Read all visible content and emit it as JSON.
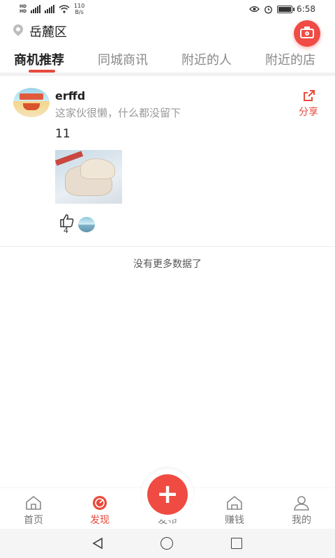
{
  "status_bar": {
    "net_speed_value": "110",
    "net_speed_unit": "B/s",
    "time": "6:58",
    "battery_level": 0.9
  },
  "header": {
    "location": "岳麓区"
  },
  "tabs": [
    {
      "label": "商机推荐",
      "active": true
    },
    {
      "label": "同城商讯",
      "active": false
    },
    {
      "label": "附近的人",
      "active": false
    },
    {
      "label": "附近的店",
      "active": false
    }
  ],
  "post": {
    "username": "erffd",
    "bio": "这家伙很懒，什么都没留下",
    "share_label": "分享",
    "text": "11",
    "like_count": "4"
  },
  "feed_end_text": "没有更多数据了",
  "bottom_nav": [
    {
      "label": "首页",
      "icon": "home-icon",
      "active": false
    },
    {
      "label": "发现",
      "icon": "discover-icon",
      "active": true
    },
    {
      "label": "发布",
      "icon": "plus-icon",
      "active": false
    },
    {
      "label": "赚钱",
      "icon": "earn-icon",
      "active": false
    },
    {
      "label": "我的",
      "icon": "profile-icon",
      "active": false
    }
  ],
  "colors": {
    "accent": "#e84a3c",
    "publish": "#ef4b42"
  }
}
